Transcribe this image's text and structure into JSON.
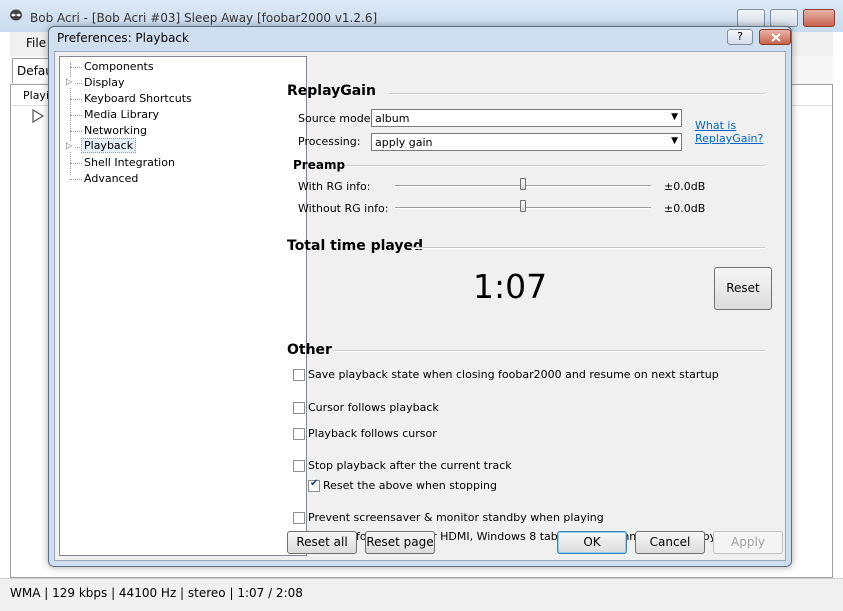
{
  "main_window": {
    "title": "Bob Acri - [Bob Acri #03] Sleep Away   [foobar2000 v1.2.6]",
    "menu": [
      "File"
    ],
    "tab_label": "Defaul",
    "playlist_header": "Playi..",
    "status": "WMA | 129 kbps | 44100 Hz | stereo | 1:07 / 2:08"
  },
  "dialog": {
    "title": "Preferences: Playback",
    "help_label": "?",
    "tree": [
      {
        "label": "Components",
        "expandable": false
      },
      {
        "label": "Display",
        "expandable": true
      },
      {
        "label": "Keyboard Shortcuts",
        "expandable": false
      },
      {
        "label": "Media Library",
        "expandable": false
      },
      {
        "label": "Networking",
        "expandable": false
      },
      {
        "label": "Playback",
        "expandable": true,
        "selected": true
      },
      {
        "label": "Shell Integration",
        "expandable": false
      },
      {
        "label": "Advanced",
        "expandable": false
      }
    ],
    "replaygain": {
      "title": "ReplayGain",
      "source_mode_label": "Source mode:",
      "source_mode_value": "album",
      "processing_label": "Processing:",
      "processing_value": "apply gain",
      "help_link": "What is ReplayGain?",
      "help_link_line1": "What is",
      "help_link_line2": "ReplayGain?",
      "preamp_title": "Preamp",
      "with_rg_label": "With RG info:",
      "with_rg_value": "±0.0dB",
      "with_rg_level": 0.5,
      "without_rg_label": "Without RG info:",
      "without_rg_value": "±0.0dB",
      "without_rg_level": 0.5
    },
    "total_time": {
      "title": "Total time played",
      "value": "1:07",
      "reset_label": "Reset"
    },
    "other": {
      "title": "Other",
      "options": [
        {
          "label": "Save playback state when closing foobar2000 and resume on next startup",
          "checked": false
        },
        {
          "label": "Cursor follows playback",
          "checked": false
        },
        {
          "label": "Playback follows cursor",
          "checked": false
        },
        {
          "label": "Stop playback after the current track",
          "checked": false
        },
        {
          "label": "Reset the above when stopping",
          "checked": true
        },
        {
          "label": "Prevent screensaver & monitor standby when playing",
          "checked": false
        }
      ],
      "note": "Needed for: audio over HDMI, Windows 8 tablets with Connected Standby"
    },
    "buttons": {
      "reset_all": "Reset all",
      "reset_page": "Reset page",
      "ok": "OK",
      "cancel": "Cancel",
      "apply": "Apply"
    }
  }
}
